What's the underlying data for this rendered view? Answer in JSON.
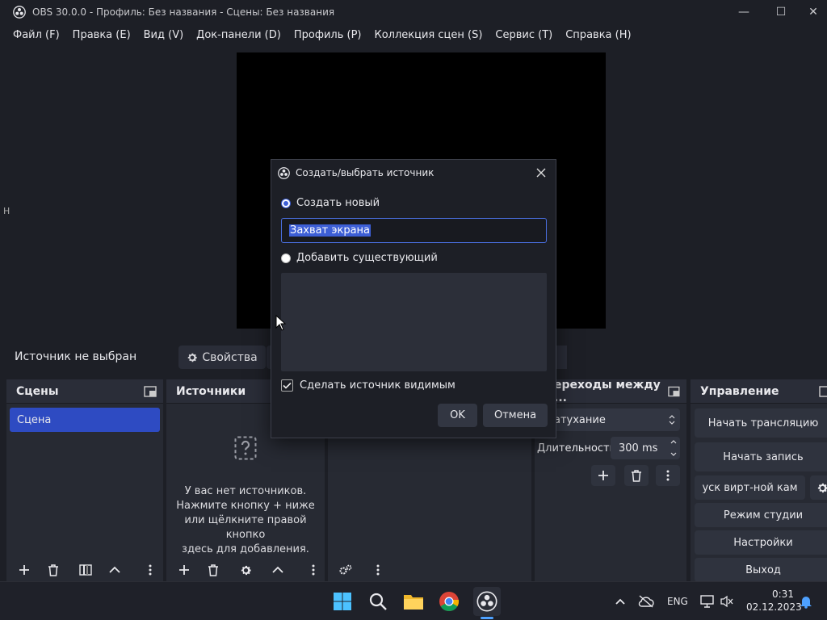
{
  "window": {
    "title": "OBS 30.0.0 - Профиль: Без названия - Сцены: Без названия",
    "minimize_icon": "—",
    "maximize_icon": "☐",
    "close_icon": "✕"
  },
  "menu": [
    "Файл (F)",
    "Правка (E)",
    "Вид (V)",
    "Док-панели (D)",
    "Профиль (P)",
    "Коллекция сцен (S)",
    "Сервис (T)",
    "Справка (H)"
  ],
  "left_edge_mark": "Н",
  "source_bar": {
    "no_source": "Источник не выбран",
    "properties_label": "Свойства"
  },
  "scenes": {
    "title": "Сцены",
    "items": [
      "Сцена"
    ]
  },
  "sources": {
    "title": "Источники",
    "empty_lines": [
      "У вас нет источников.",
      "Нажмите кнопку + ниже",
      "или щёлкните правой кнопко",
      "здесь для добавления."
    ]
  },
  "transitions": {
    "title": "ереходы между ...",
    "selected": "атухание",
    "duration_label": "Длительность",
    "duration_value": "300 ms"
  },
  "controls": {
    "title": "Управление",
    "start_stream": "Начать трансляцию",
    "start_record": "Начать запись",
    "virtual_cam": "уск вирт-ной кам",
    "studio_mode": "Режим студии",
    "settings": "Настройки",
    "exit": "Выход"
  },
  "dialog": {
    "title": "Создать/выбрать источник",
    "create_new_label": "Создать новый",
    "name_value": "Захват экрана",
    "add_existing_label": "Добавить существующий",
    "visible_label": "Сделать источник видимым",
    "ok": "OK",
    "cancel": "Отмена"
  },
  "taskbar": {
    "lang": "ENG",
    "time": "0:31",
    "date": "02.12.2023"
  },
  "colors": {
    "accent": "#2e4bc2",
    "background": "#1d1f26",
    "panel": "#272a33"
  }
}
